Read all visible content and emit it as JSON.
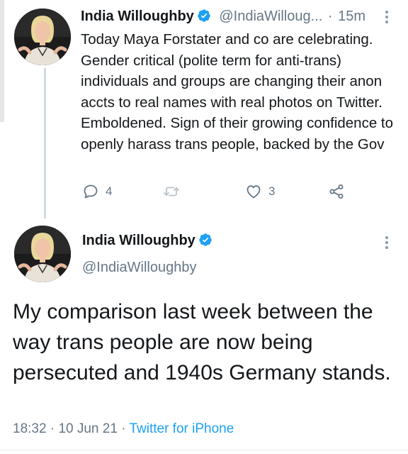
{
  "tweet1": {
    "display_name": "India Willoughby",
    "handle": "@IndiaWilloug...",
    "separator": "·",
    "time": "15m",
    "text": "Today Maya Forstater and co are celebrating. Gender critical (polite term for anti-trans) individuals and groups are changing their anon accts to real names with real photos on Twitter. Emboldened. Sign of their growing confidence to openly harass trans people, backed by the Gov",
    "reply_count": "4",
    "like_count": "3",
    "icons": [
      "verified-badge-icon",
      "more-vertical-icon",
      "reply-icon",
      "retweet-icon",
      "like-icon",
      "share-icon"
    ]
  },
  "tweet2": {
    "display_name": "India Willoughby",
    "handle": "@IndiaWilloughby",
    "text": "My comparison last week between the way trans people are now being persecuted and 1940s Germany stands.",
    "time": "18:32",
    "separator": "·",
    "date": "10 Jun 21",
    "source": "Twitter for iPhone"
  },
  "colors": {
    "text": "#14171a",
    "muted": "#657786",
    "verified": "#1da1f2",
    "link": "#1da1f2",
    "thread_line": "#cfd9de"
  }
}
